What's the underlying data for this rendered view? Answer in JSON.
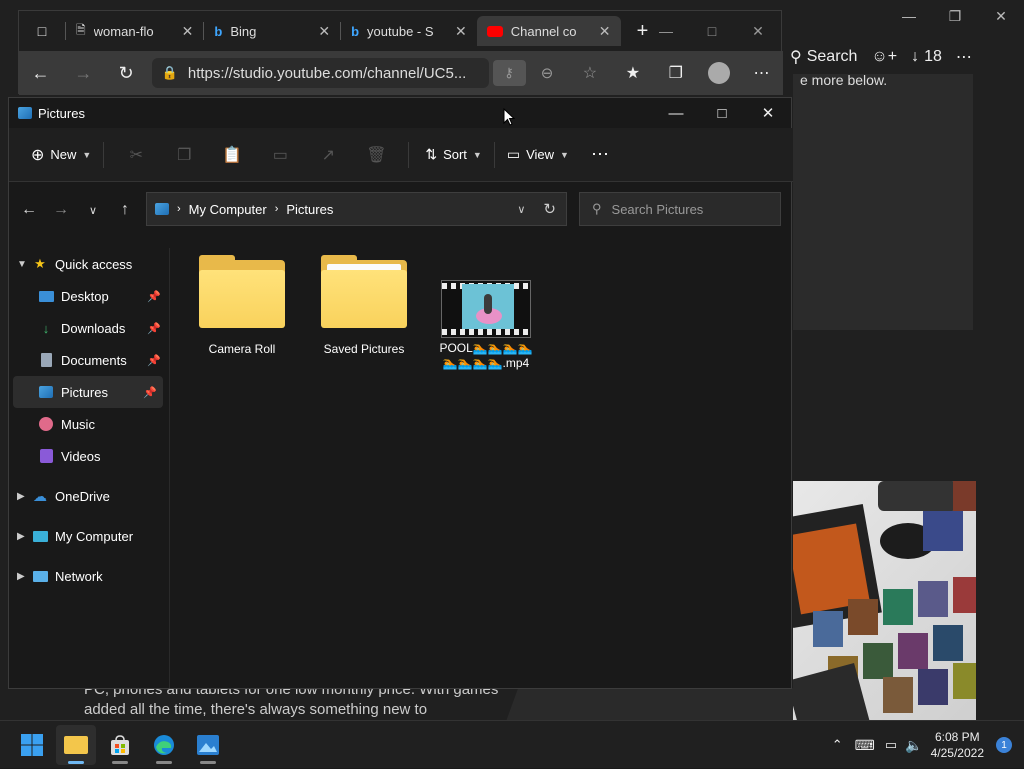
{
  "background_browser": {
    "toolbar": {
      "search_label": "Search",
      "downloads_count": "18"
    },
    "page_snippet": "e more below.",
    "bottom_text": "PC, phones and tablets for one low monthly price. With games added all the time, there's always something new to"
  },
  "edge": {
    "tabs": [
      {
        "label": "woman-flo",
        "icon": "page-icon",
        "active": false
      },
      {
        "label": "Bing",
        "icon": "bing-icon",
        "active": false
      },
      {
        "label": "youtube - S",
        "icon": "bing-icon",
        "active": false
      },
      {
        "label": "Channel co",
        "icon": "youtube-icon",
        "active": true
      }
    ],
    "url": "https://studio.youtube.com/channel/UC5..."
  },
  "explorer": {
    "title": "Pictures",
    "command_bar": {
      "new_label": "New",
      "sort_label": "Sort",
      "view_label": "View"
    },
    "breadcrumb": [
      "My Computer",
      "Pictures"
    ],
    "search_placeholder": "Search Pictures",
    "sidebar": {
      "items": [
        {
          "label": "Quick access",
          "icon": "star-icon",
          "level": 0,
          "expanded": true,
          "pinned": false
        },
        {
          "label": "Desktop",
          "icon": "desktop-icon",
          "level": 1,
          "pinned": true
        },
        {
          "label": "Downloads",
          "icon": "download-icon",
          "level": 1,
          "pinned": true
        },
        {
          "label": "Documents",
          "icon": "document-icon",
          "level": 1,
          "pinned": true
        },
        {
          "label": "Pictures",
          "icon": "pictures-icon",
          "level": 1,
          "pinned": true,
          "selected": true
        },
        {
          "label": "Music",
          "icon": "music-icon",
          "level": 1,
          "pinned": false
        },
        {
          "label": "Videos",
          "icon": "videos-icon",
          "level": 1,
          "pinned": false
        },
        {
          "label": "OneDrive",
          "icon": "cloud-icon",
          "level": 0,
          "expanded": false
        },
        {
          "label": "My Computer",
          "icon": "computer-icon",
          "level": 0,
          "expanded": false
        },
        {
          "label": "Network",
          "icon": "network-icon",
          "level": 0,
          "expanded": false
        }
      ]
    },
    "files": [
      {
        "name": "Camera Roll",
        "type": "folder"
      },
      {
        "name": "Saved Pictures",
        "type": "folder"
      },
      {
        "name": "POOL🏊🏊🏊🏊🏊🏊🏊🏊.mp4",
        "type": "video"
      }
    ]
  },
  "taskbar": {
    "apps": [
      "start",
      "file-explorer",
      "store",
      "edge",
      "photos"
    ],
    "time": "6:08 PM",
    "date": "4/25/2022",
    "notification_count": "1"
  }
}
